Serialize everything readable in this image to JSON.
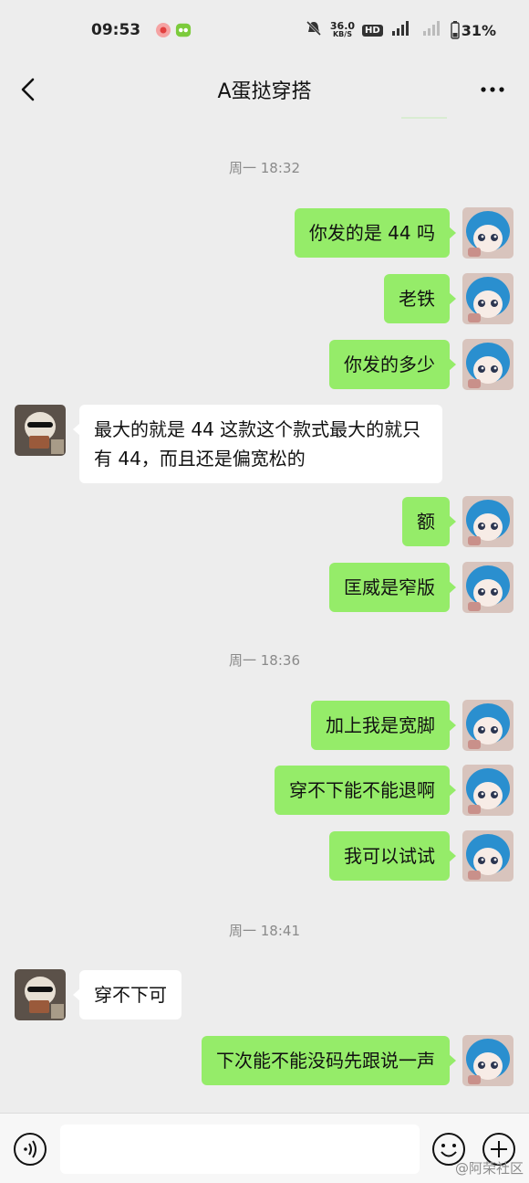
{
  "status": {
    "time": "09:53",
    "speed_value": "36.0",
    "speed_unit": "KB/S",
    "hd": "HD",
    "battery": "31%"
  },
  "header": {
    "title": "A蛋挞穿搭"
  },
  "messages": [
    {
      "type": "time",
      "text": "周一 18:32"
    },
    {
      "type": "me",
      "text": "你发的是 44 吗"
    },
    {
      "type": "me",
      "text": "老铁"
    },
    {
      "type": "me",
      "text": "你发的多少"
    },
    {
      "type": "other",
      "text": "最大的就是 44 这款这个款式最大的就只有 44，而且还是偏宽松的"
    },
    {
      "type": "me",
      "text": "额"
    },
    {
      "type": "me",
      "text": "匡威是窄版"
    },
    {
      "type": "time",
      "text": "周一 18:36"
    },
    {
      "type": "me",
      "text": "加上我是宽脚"
    },
    {
      "type": "me",
      "text": "穿不下能不能退啊"
    },
    {
      "type": "me",
      "text": "我可以试试"
    },
    {
      "type": "time",
      "text": "周一 18:41"
    },
    {
      "type": "other",
      "text": "穿不下可"
    },
    {
      "type": "me",
      "text": "下次能不能没码先跟说一声"
    }
  ],
  "input": {
    "value": ""
  },
  "watermark": "@阿荣社区",
  "colors": {
    "background": "#ededed",
    "my_bubble": "#95ec69",
    "other_bubble": "#ffffff"
  },
  "icons": [
    "back-arrow-icon",
    "more-icon",
    "voice-icon",
    "emoji-icon",
    "plus-icon"
  ]
}
